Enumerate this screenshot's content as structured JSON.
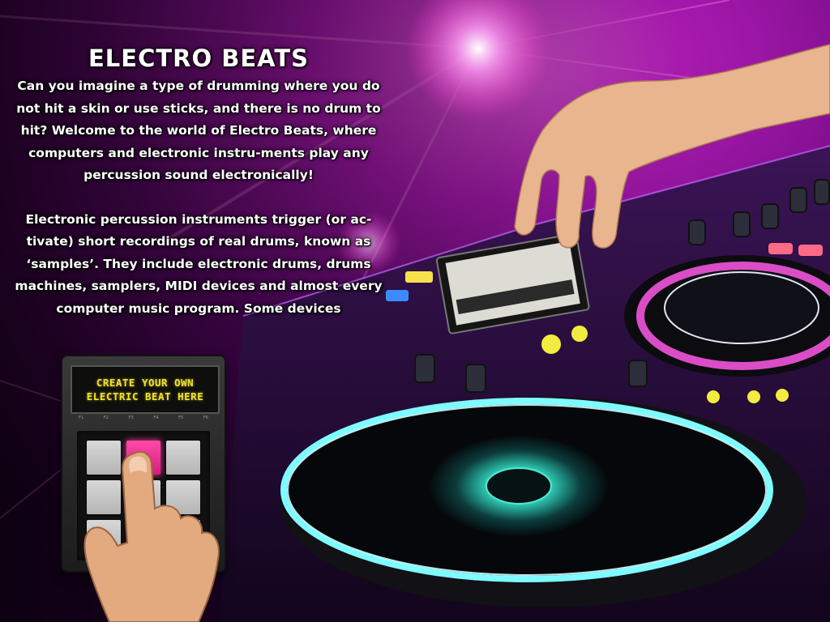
{
  "title": "ELECTRO BEATS",
  "paragraphs": [
    "Can you imagine a type of drumming where you do not hit a skin or use sticks, and there is no drum to hit? Welcome to the world of Electro Beats, where computers and electronic instru-ments play any percussion sound electronically!",
    "Electronic percussion instruments trigger (or ac-tivate) short recordings of real drums, known as ‘samples’. They include electronic drums, drums machines, samplers, MIDI devices and almost every computer music program. Some devices"
  ],
  "drum_pad": {
    "screen_line_1": "CREATE YOUR OWN",
    "screen_line_2": "ELECTRIC BEAT HERE",
    "function_labels": [
      "F1",
      "F2",
      "F3",
      "F4",
      "F5",
      "F6"
    ],
    "active_pad_color": "#e8288c"
  },
  "colors": {
    "text": "#ffffff",
    "lcd_text": "#f0e32a",
    "neon_magenta": "#ff2fd0",
    "neon_cyan": "#5ff5ff"
  }
}
